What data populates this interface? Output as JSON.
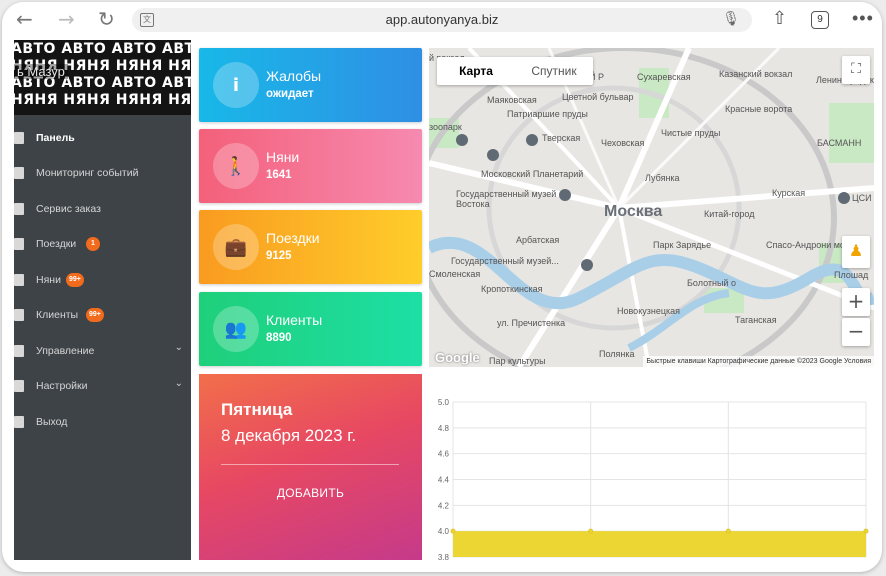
{
  "browser": {
    "url": "app.autonyanya.biz",
    "tab_count": "9",
    "back_icon": "back-arrow-icon",
    "forward_icon": "forward-arrow-icon",
    "reload_icon": "reload-icon",
    "translate_icon": "translate-icon",
    "mic_icon": "microphone-icon",
    "share_icon": "share-icon",
    "more_icon": "more-icon"
  },
  "sidebar": {
    "banner_word_top": "АВТО",
    "banner_word_bottom": "НЯНЯ",
    "user_name": "ь Мазур",
    "items": [
      {
        "label": "Панель",
        "icon": "dashboard-icon",
        "active": true
      },
      {
        "label": "Мониторинг событий",
        "icon": "search-icon"
      },
      {
        "label": "Сервис заказ",
        "icon": "wifi-icon"
      },
      {
        "label": "Поездки",
        "icon": "briefcase-icon",
        "badge": "1"
      },
      {
        "label": "Няни",
        "icon": "walker-icon",
        "badge": "99+"
      },
      {
        "label": "Клиенты",
        "icon": "users-icon",
        "badge": "99+"
      },
      {
        "label": "Управление",
        "icon": "building-icon",
        "expandable": true
      },
      {
        "label": "Настройки",
        "icon": "gear-icon",
        "expandable": true
      },
      {
        "label": "Выход",
        "icon": "logout-icon"
      }
    ]
  },
  "cards": [
    {
      "title": "Жалобы",
      "value": "ожидает",
      "icon": "info-icon",
      "color_from": "#18b8e8",
      "color_to": "#2f8fe4"
    },
    {
      "title": "Няни",
      "value": "1641",
      "icon": "walker-icon",
      "color_from": "#f4607a",
      "color_to": "#f68ab0"
    },
    {
      "title": "Поездки",
      "value": "9125",
      "icon": "briefcase-icon",
      "color_from": "#f99b20",
      "color_to": "#ffcd2a"
    },
    {
      "title": "Клиенты",
      "value": "8890",
      "icon": "users-icon",
      "color_from": "#1fcf7a",
      "color_to": "#1ddfa5"
    }
  ],
  "date_card": {
    "day": "Пятница",
    "date": "8 декабря 2023 г.",
    "add_button": "ДОБАВИТЬ"
  },
  "map": {
    "toggle_map": "Карта",
    "toggle_satellite": "Спутник",
    "fullscreen_icon": "fullscreen-icon",
    "pegman_icon": "pegman-icon",
    "zoom_in": "+",
    "zoom_out": "−",
    "google": "Google",
    "attribution": "Быстрые клавиши   Картографические данные ©2023 Google   Условия",
    "labels": [
      {
        "text": "Москва",
        "big": true
      },
      {
        "text": "Сухаревская"
      },
      {
        "text": "Казанский вокзал"
      },
      {
        "text": "Маяковская"
      },
      {
        "text": "Цветной бульвар"
      },
      {
        "text": "Патриаршие пруды"
      },
      {
        "text": "Тверская"
      },
      {
        "text": "Чеховская"
      },
      {
        "text": "Красные ворота"
      },
      {
        "text": "Чистые пруды"
      },
      {
        "text": "БАСМАНН"
      },
      {
        "text": "Московский Планетарий"
      },
      {
        "text": "Лубянка"
      },
      {
        "text": "Государственный музей Востока"
      },
      {
        "text": "Курская"
      },
      {
        "text": "Китай-город"
      },
      {
        "text": "Арбатская"
      },
      {
        "text": "Парк Зарядье"
      },
      {
        "text": "Спасо-Андрони монаст"
      },
      {
        "text": "Государственный музей..."
      },
      {
        "text": "Смоленская"
      },
      {
        "text": "Болотный о"
      },
      {
        "text": "Кропоткинская"
      },
      {
        "text": "Плошад"
      },
      {
        "text": "Новокузнецкая"
      },
      {
        "text": "Таганская"
      },
      {
        "text": "зоопарк"
      },
      {
        "text": "ул. Пречистенка"
      },
      {
        "text": "Полянка"
      },
      {
        "text": "Пар культуры"
      },
      {
        "text": "Лениннградск"
      },
      {
        "text": "ЦСИ"
      },
      {
        "text": "й вокзал"
      },
      {
        "text": "Й Р"
      }
    ]
  },
  "chart_data": {
    "type": "area",
    "ylim": [
      3.8,
      5.0
    ],
    "yticks": [
      "5.0",
      "4.8",
      "4.6",
      "4.4",
      "4.2",
      "4.0",
      "3.8"
    ],
    "x": [
      0,
      1,
      2,
      3
    ],
    "series": [
      {
        "values": [
          4.0,
          4.0,
          4.0,
          4.0
        ],
        "color": "#ecd633"
      }
    ]
  }
}
